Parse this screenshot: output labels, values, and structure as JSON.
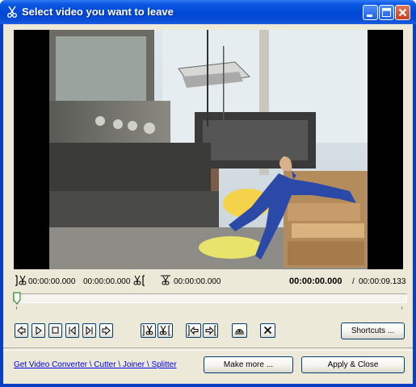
{
  "window": {
    "title": "Select video you want to leave",
    "icon": "scissors-icon",
    "title_color": "#0047d6"
  },
  "time": {
    "start": "00:00:00.000",
    "end": "00:00:00.000",
    "length": "00:00:00.000",
    "current": "00:00:00.000",
    "separator": "/",
    "total": "00:00:09.133"
  },
  "controls": {
    "shortcuts_label": "Shortcuts ..."
  },
  "footer": {
    "link_text": "Get Video Converter \\ Cutter \\ Joiner \\ Splitter",
    "make_more_label": "Make more ...",
    "apply_label": "Apply & Close"
  },
  "colors": {
    "link": "#0000ee",
    "dialog_bg": "#ece9d8",
    "button_border": "#003c74"
  }
}
